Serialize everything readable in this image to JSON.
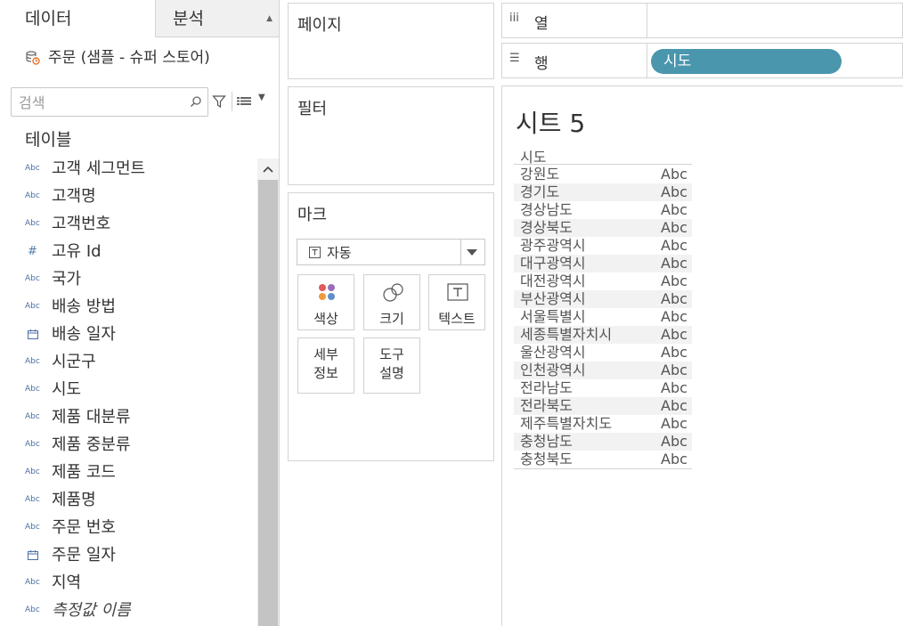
{
  "data_pane": {
    "tabs": {
      "data": "데이터",
      "analysis": "분석"
    },
    "datasource": "주문 (샘플 - 슈퍼 스토어)",
    "search": {
      "placeholder": "검색",
      "value": ""
    },
    "section_title": "테이블",
    "fields": [
      {
        "label": "고객 세그먼트",
        "type": "Abc",
        "icon": "abc-icon",
        "italic": false
      },
      {
        "label": "고객명",
        "type": "Abc",
        "icon": "abc-icon",
        "italic": false
      },
      {
        "label": "고객번호",
        "type": "Abc",
        "icon": "abc-icon",
        "italic": false
      },
      {
        "label": "고유 Id",
        "type": "#",
        "icon": "number-icon",
        "italic": false
      },
      {
        "label": "국가",
        "type": "Abc",
        "icon": "abc-icon",
        "italic": false
      },
      {
        "label": "배송 방법",
        "type": "Abc",
        "icon": "abc-icon",
        "italic": false
      },
      {
        "label": "배송 일자",
        "type": "date",
        "icon": "calendar-icon",
        "italic": false
      },
      {
        "label": "시군구",
        "type": "Abc",
        "icon": "abc-icon",
        "italic": false
      },
      {
        "label": "시도",
        "type": "Abc",
        "icon": "abc-icon",
        "italic": false
      },
      {
        "label": "제품 대분류",
        "type": "Abc",
        "icon": "abc-icon",
        "italic": false
      },
      {
        "label": "제품 중분류",
        "type": "Abc",
        "icon": "abc-icon",
        "italic": false
      },
      {
        "label": "제품 코드",
        "type": "Abc",
        "icon": "abc-icon",
        "italic": false
      },
      {
        "label": "제품명",
        "type": "Abc",
        "icon": "abc-icon",
        "italic": false
      },
      {
        "label": "주문 번호",
        "type": "Abc",
        "icon": "abc-icon",
        "italic": false
      },
      {
        "label": "주문 일자",
        "type": "date",
        "icon": "calendar-icon",
        "italic": false
      },
      {
        "label": "지역",
        "type": "Abc",
        "icon": "abc-icon",
        "italic": false
      },
      {
        "label": "측정값 이름",
        "type": "Abc",
        "icon": "abc-icon",
        "italic": true
      }
    ]
  },
  "cards": {
    "pages": "페이지",
    "filters": "필터",
    "marks": {
      "title": "마크",
      "type_selected": "자동",
      "buttons": {
        "color": "색상",
        "size": "크기",
        "text": "텍스트",
        "detail_line1": "세부",
        "detail_line2": "정보",
        "tooltip_line1": "도구",
        "tooltip_line2": "설명"
      }
    }
  },
  "shelves": {
    "columns": {
      "icon": "iii",
      "label": "열"
    },
    "rows": {
      "icon": "☰",
      "label": "행",
      "pill": "시도"
    }
  },
  "sheet": {
    "title": "시트 5",
    "column_header": "시도",
    "rows": [
      {
        "name": "강원도",
        "value": "Abc"
      },
      {
        "name": "경기도",
        "value": "Abc"
      },
      {
        "name": "경상남도",
        "value": "Abc"
      },
      {
        "name": "경상북도",
        "value": "Abc"
      },
      {
        "name": "광주광역시",
        "value": "Abc"
      },
      {
        "name": "대구광역시",
        "value": "Abc"
      },
      {
        "name": "대전광역시",
        "value": "Abc"
      },
      {
        "name": "부산광역시",
        "value": "Abc"
      },
      {
        "name": "서울특별시",
        "value": "Abc"
      },
      {
        "name": "세종특별자치시",
        "value": "Abc"
      },
      {
        "name": "울산광역시",
        "value": "Abc"
      },
      {
        "name": "인천광역시",
        "value": "Abc"
      },
      {
        "name": "전라남도",
        "value": "Abc"
      },
      {
        "name": "전라북도",
        "value": "Abc"
      },
      {
        "name": "제주특별자치도",
        "value": "Abc"
      },
      {
        "name": "충청남도",
        "value": "Abc"
      },
      {
        "name": "충청북도",
        "value": "Abc"
      }
    ]
  },
  "colors": {
    "pill": "#4a96ad",
    "field_icon": "#4a6fa5"
  }
}
